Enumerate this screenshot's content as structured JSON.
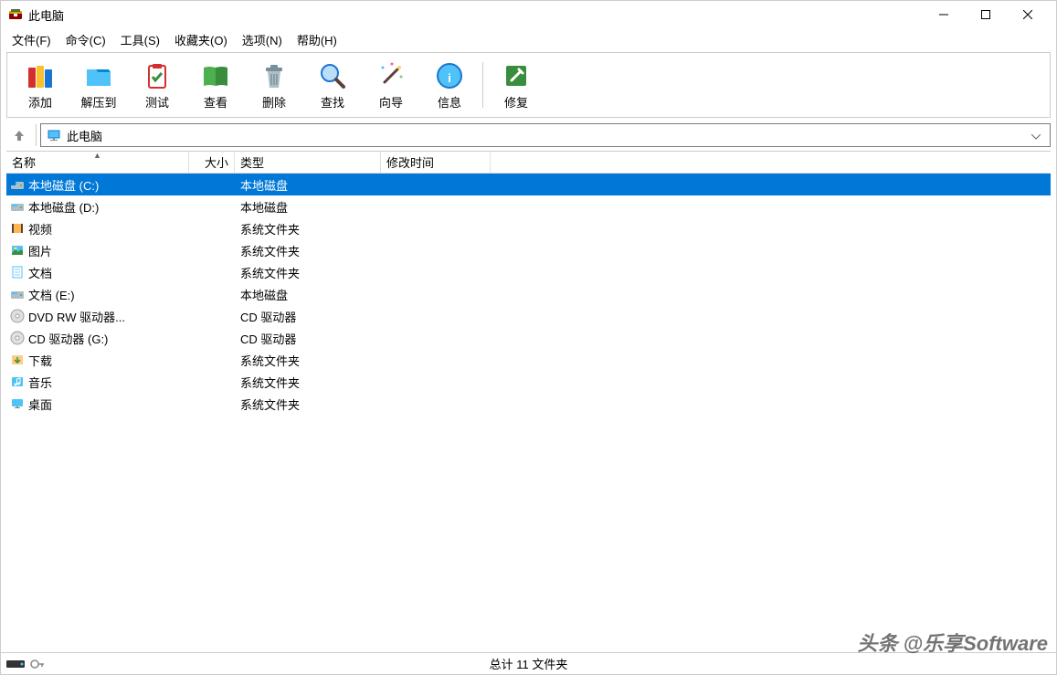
{
  "window": {
    "title": "此电脑"
  },
  "menu": {
    "file": "文件(F)",
    "command": "命令(C)",
    "tools": "工具(S)",
    "favorites": "收藏夹(O)",
    "options": "选项(N)",
    "help": "帮助(H)"
  },
  "toolbar": {
    "add": "添加",
    "extract": "解压到",
    "test": "测试",
    "view": "查看",
    "delete": "删除",
    "find": "查找",
    "wizard": "向导",
    "info": "信息",
    "repair": "修复"
  },
  "address": {
    "path": "此电脑"
  },
  "columns": {
    "name": "名称",
    "size": "大小",
    "type": "类型",
    "date": "修改时间"
  },
  "items": [
    {
      "name": "本地磁盘 (C:)",
      "type": "本地磁盘",
      "icon": "drive-c",
      "selected": true
    },
    {
      "name": "本地磁盘 (D:)",
      "type": "本地磁盘",
      "icon": "drive"
    },
    {
      "name": "视频",
      "type": "系统文件夹",
      "icon": "video"
    },
    {
      "name": "图片",
      "type": "系统文件夹",
      "icon": "picture"
    },
    {
      "name": "文档",
      "type": "系统文件夹",
      "icon": "document"
    },
    {
      "name": "文档 (E:)",
      "type": "本地磁盘",
      "icon": "drive"
    },
    {
      "name": "DVD RW 驱动器...",
      "type": "CD 驱动器",
      "icon": "disc"
    },
    {
      "name": "CD 驱动器 (G:)",
      "type": "CD 驱动器",
      "icon": "disc"
    },
    {
      "name": "下载",
      "type": "系统文件夹",
      "icon": "download"
    },
    {
      "name": "音乐",
      "type": "系统文件夹",
      "icon": "music"
    },
    {
      "name": "桌面",
      "type": "系统文件夹",
      "icon": "desktop"
    }
  ],
  "status": {
    "text": "总计 11 文件夹"
  },
  "watermark": "头条 @乐享Software"
}
